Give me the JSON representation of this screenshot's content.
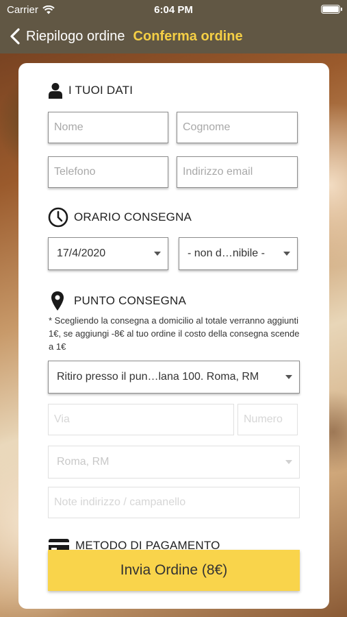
{
  "status_bar": {
    "carrier": "Carrier",
    "time": "6:04 PM"
  },
  "nav": {
    "back_label": "Riepilogo ordine",
    "title": "Conferma ordine"
  },
  "sections": {
    "personal": "I TUOI DATI",
    "delivery_time": "ORARIO CONSEGNA",
    "delivery_point": "PUNTO CONSEGNA",
    "payment": "METODO DI PAGAMENTO"
  },
  "fields": {
    "first_name_placeholder": "Nome",
    "last_name_placeholder": "Cognome",
    "phone_placeholder": "Telefono",
    "email_placeholder": "Indirizzo email",
    "street_placeholder": "Via",
    "number_placeholder": "Numero",
    "address_note_placeholder": "Note indirizzo / campanello"
  },
  "selects": {
    "date": "17/4/2020",
    "time_slot": "- non d…nibile -",
    "pickup_point": "Ritiro presso il pun…lana 100. Roma, RM",
    "city": "Roma, RM"
  },
  "delivery_note": "* Scegliendo la consegna a domicilio al totale verranno aggiunti 1€, se aggiungi -8€ al tuo ordine il costo della consegna scende a 1€",
  "submit_label": "Invia Ordine (8€)",
  "colors": {
    "nav_bg": "#615744",
    "accent": "#f5cf45",
    "button": "#f9d44b"
  },
  "icons": [
    "wifi-icon",
    "battery-icon",
    "back-chevron-icon",
    "person-icon",
    "clock-icon",
    "location-pin-icon",
    "credit-card-icon",
    "dropdown-arrow-icon"
  ]
}
